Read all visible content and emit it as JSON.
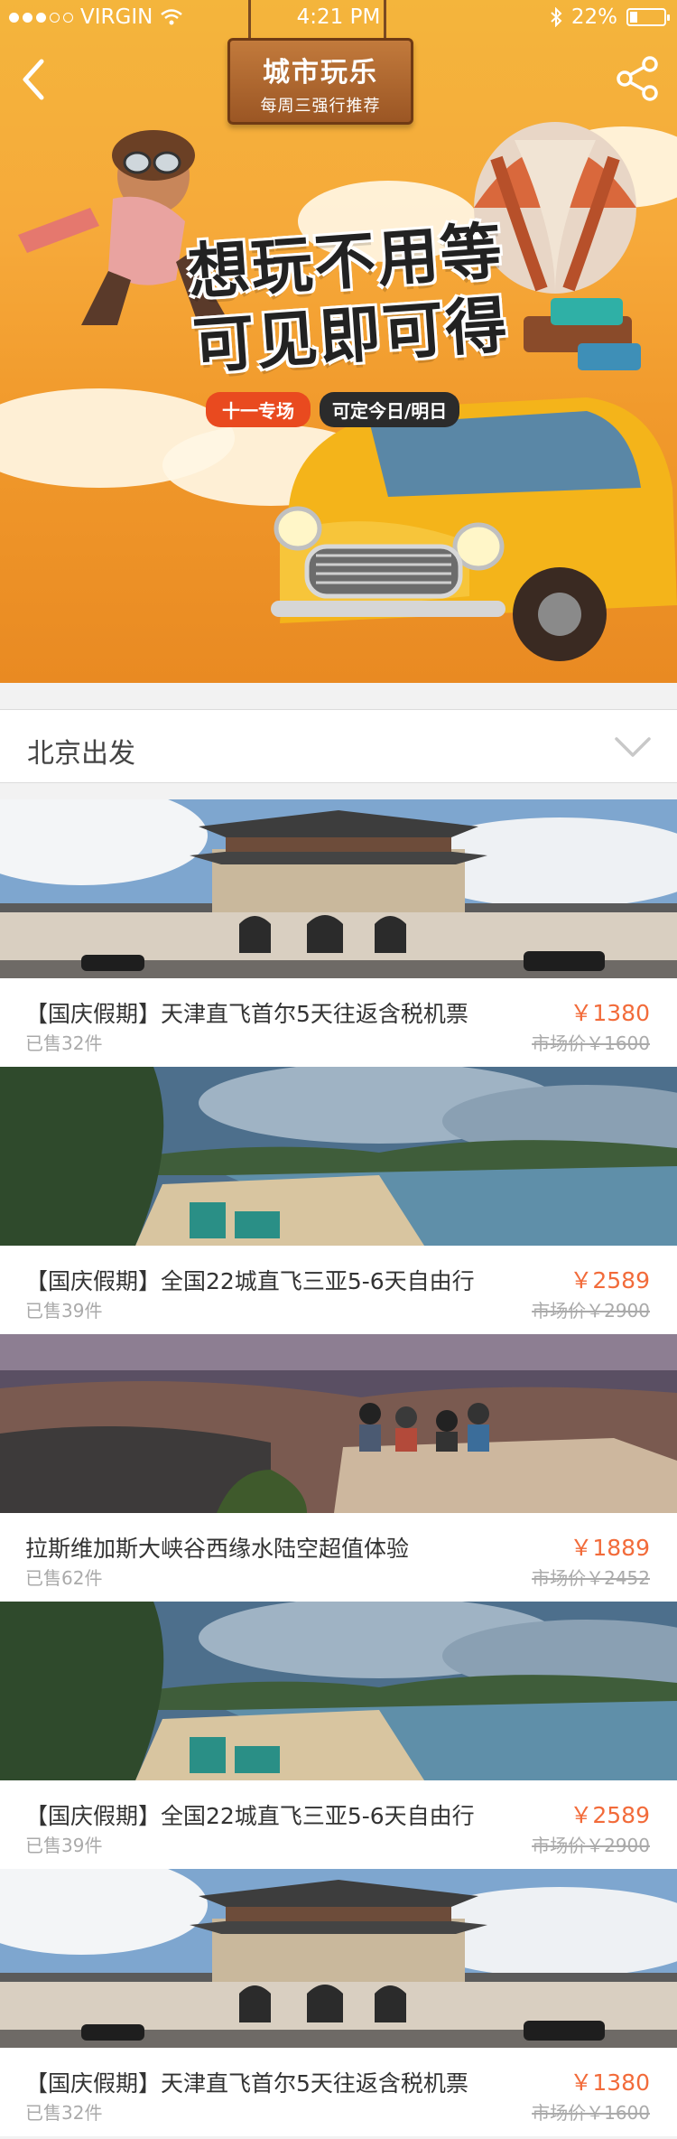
{
  "status_bar": {
    "carrier": "VIRGIN",
    "time": "4:21 PM",
    "battery": "22%",
    "battery_level": 0.22
  },
  "hero": {
    "sign_title": "城市玩乐",
    "sign_subtitle": "每周三强行推荐",
    "headline_line1": "想玩不用等",
    "headline_line2": "可见即可得",
    "tag_special": "十一专场",
    "tag_bookable": "可定今日/明日"
  },
  "filter": {
    "departure": "北京出发"
  },
  "products": [
    {
      "title": "【国庆假期】天津直飞首尔5天往返含税机票",
      "sold": "已售32件",
      "price": "￥1380",
      "market_price": "市场价￥1600",
      "image": "palace"
    },
    {
      "title": "【国庆假期】全国22城直飞三亚5-6天自由行",
      "sold": "已售39件",
      "price": "￥2589",
      "market_price": "市场价￥2900",
      "image": "beach"
    },
    {
      "title": "拉斯维加斯大峡谷西缘水陆空超值体验",
      "sold": "已售62件",
      "price": "￥1889",
      "market_price": "市场价￥2452",
      "image": "canyon"
    },
    {
      "title": "【国庆假期】全国22城直飞三亚5-6天自由行",
      "sold": "已售39件",
      "price": "￥2589",
      "market_price": "市场价￥2900",
      "image": "beach"
    },
    {
      "title": "【国庆假期】天津直飞首尔5天往返含税机票",
      "sold": "已售32件",
      "price": "￥1380",
      "market_price": "市场价￥1600",
      "image": "palace"
    }
  ],
  "colors": {
    "price": "#f26b3a",
    "hero_orange": "#f19a2c",
    "tag_red": "#e94a1f"
  }
}
